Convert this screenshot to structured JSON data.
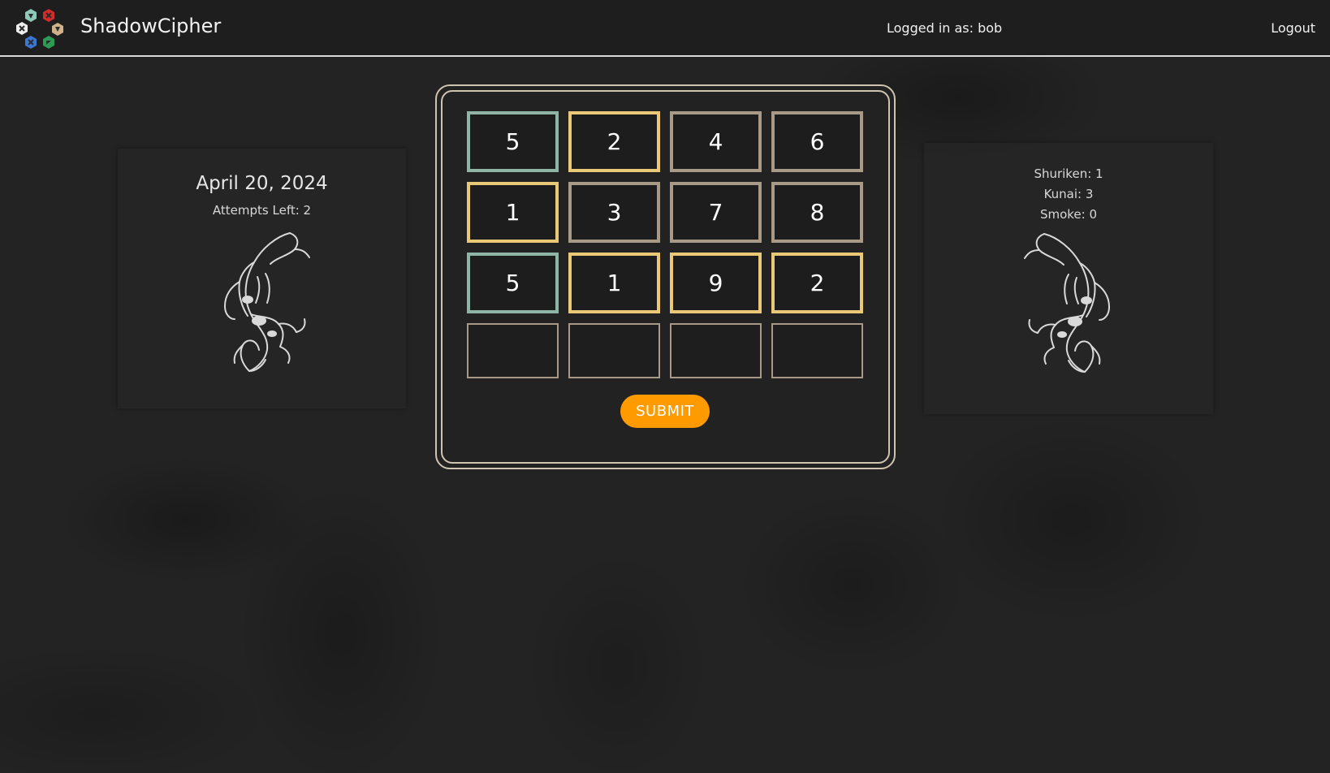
{
  "header": {
    "brand": "ShadowCipher",
    "user_label": "Logged in as: bob",
    "logout_label": "Logout"
  },
  "left_card": {
    "date": "April 20, 2024",
    "attempts": "Attempts Left: 2"
  },
  "right_card": {
    "shuriken": "Shuriken: 1",
    "kunai": "Kunai: 3",
    "smoke": "Smoke: 0"
  },
  "board": {
    "rows": [
      [
        {
          "value": "5",
          "status": "green"
        },
        {
          "value": "2",
          "status": "yellow"
        },
        {
          "value": "4",
          "status": "gray"
        },
        {
          "value": "6",
          "status": "gray"
        }
      ],
      [
        {
          "value": "1",
          "status": "yellow"
        },
        {
          "value": "3",
          "status": "gray"
        },
        {
          "value": "7",
          "status": "gray"
        },
        {
          "value": "8",
          "status": "gray"
        }
      ],
      [
        {
          "value": "5",
          "status": "green"
        },
        {
          "value": "1",
          "status": "yellow"
        },
        {
          "value": "9",
          "status": "yellow"
        },
        {
          "value": "2",
          "status": "yellow"
        }
      ],
      [
        {
          "value": "",
          "status": "empty"
        },
        {
          "value": "",
          "status": "empty"
        },
        {
          "value": "",
          "status": "empty"
        },
        {
          "value": "",
          "status": "empty"
        }
      ]
    ],
    "submit_label": "SUBMIT"
  },
  "colors": {
    "correct": "#8fb5a7",
    "present": "#e9c878",
    "absent": "#a89a86",
    "submit": "#ff9a00"
  },
  "icons": [
    "logo-icon",
    "koi-fish-icon"
  ]
}
